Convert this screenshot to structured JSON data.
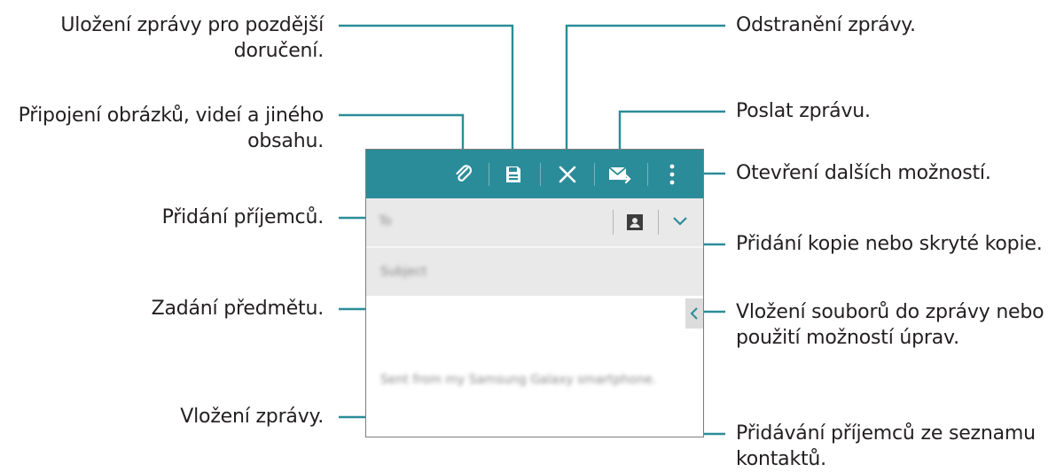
{
  "callouts": {
    "save_later": "Uložení zprávy pro pozdější\ndoručení.",
    "attach": "Připojení obrázků, videí a jiného\nobsahu.",
    "add_recipients": "Přidání příjemců.",
    "enter_subject": "Zadání předmětu.",
    "enter_message": "Vložení zprávy.",
    "delete_message": "Odstranění zprávy.",
    "send_message": "Poslat zprávu.",
    "more_options": "Otevření dalších možností.",
    "add_cc_bcc": "Přidání kopie nebo skryté kopie.",
    "insert_files": "Vložení souborů do zprávy nebo\npoužití možností úprav.",
    "add_from_contacts": "Přidávání příjemců ze seznamu\nkontaktů."
  },
  "compose": {
    "to_placeholder": "To",
    "subject_placeholder": "Subject",
    "signature": "Sent from my Samsung Galaxy smartphone."
  },
  "toolbar": {
    "icons": [
      "attach-icon",
      "save-icon",
      "close-icon",
      "send-icon",
      "more-icon"
    ]
  },
  "colors": {
    "toolbar": "#2b8c99",
    "callout_line": "#2b8c99",
    "field_bg": "#e9e9e9"
  }
}
